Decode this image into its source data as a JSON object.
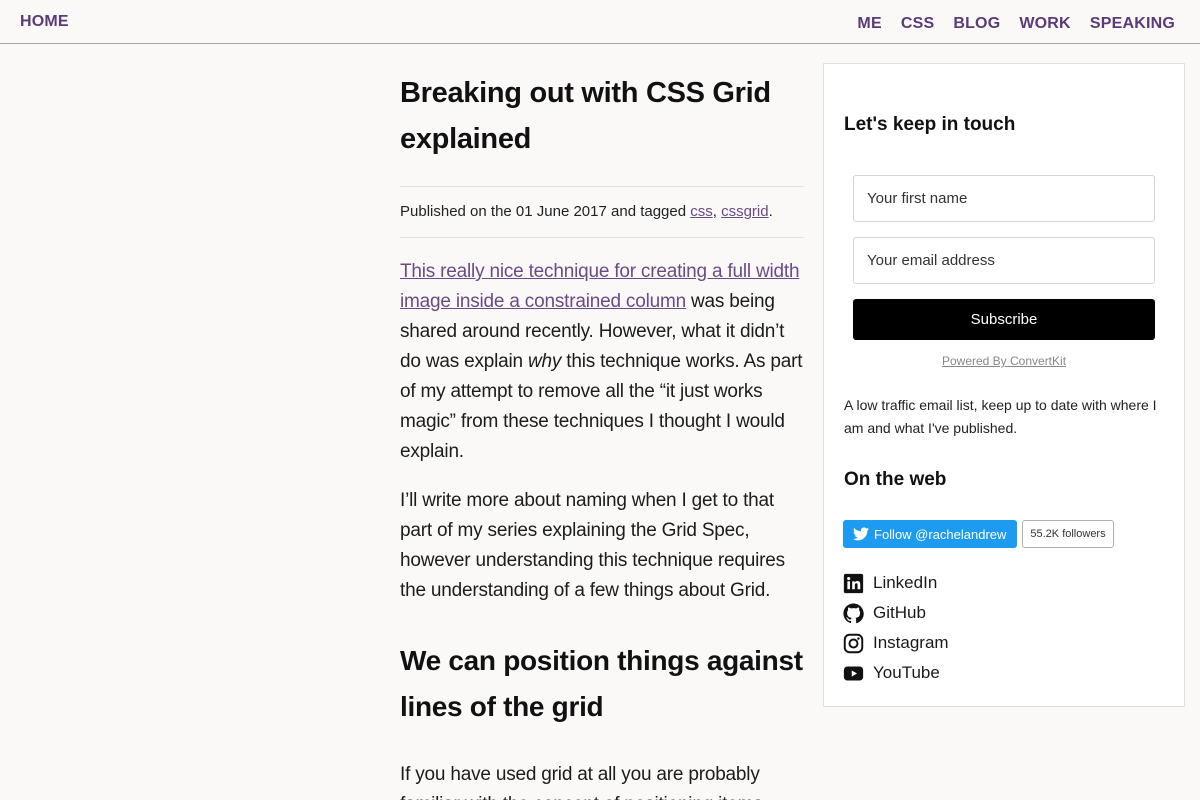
{
  "nav": {
    "home": "HOME",
    "items": [
      "ME",
      "CSS",
      "BLOG",
      "WORK",
      "SPEAKING"
    ]
  },
  "article": {
    "title": "Breaking out with CSS Grid explained",
    "meta": {
      "prefix": "Published on the 01 June 2017 and tagged ",
      "tags": [
        "css",
        "cssgrid"
      ],
      "separator": ", ",
      "suffix": "."
    },
    "p1": {
      "link": "This really nice technique for creating a full width image inside a constrained column",
      "text_a": " was being shared around recently. However, what it didn’t do was explain ",
      "emphasis": "why",
      "text_b": " this technique works. As part of my attempt to remove all the “it just works magic” from these techniques I thought I would explain."
    },
    "p2": "I’ll write more about naming when I get to that part of my series explaining the Grid Spec, however understanding this technique requires the understanding of a few things about Grid.",
    "h2": "We can position things against lines of the grid",
    "p3": "If you have used grid at all you are probably familiar with the concept of positioning items"
  },
  "sidebar": {
    "newsletter_title": "Let's keep in touch",
    "first_name_placeholder": "Your first name",
    "email_placeholder": "Your email address",
    "subscribe_label": "Subscribe",
    "powered_by": "Powered By ConvertKit",
    "description": "A low traffic email list, keep up to date with where I am and what I've published.",
    "web_title": "On the web",
    "twitter_follow": "Follow @rachelandrew",
    "twitter_followers": "55.2K followers",
    "social": [
      {
        "label": "LinkedIn",
        "icon": "linkedin-icon"
      },
      {
        "label": "GitHub",
        "icon": "github-icon"
      },
      {
        "label": "Instagram",
        "icon": "instagram-icon"
      },
      {
        "label": "YouTube",
        "icon": "youtube-icon"
      }
    ]
  },
  "colors": {
    "accent": "#5c3a78",
    "link": "#6b4a86",
    "twitter": "#1d9bf0",
    "background": "#faf9f8"
  }
}
